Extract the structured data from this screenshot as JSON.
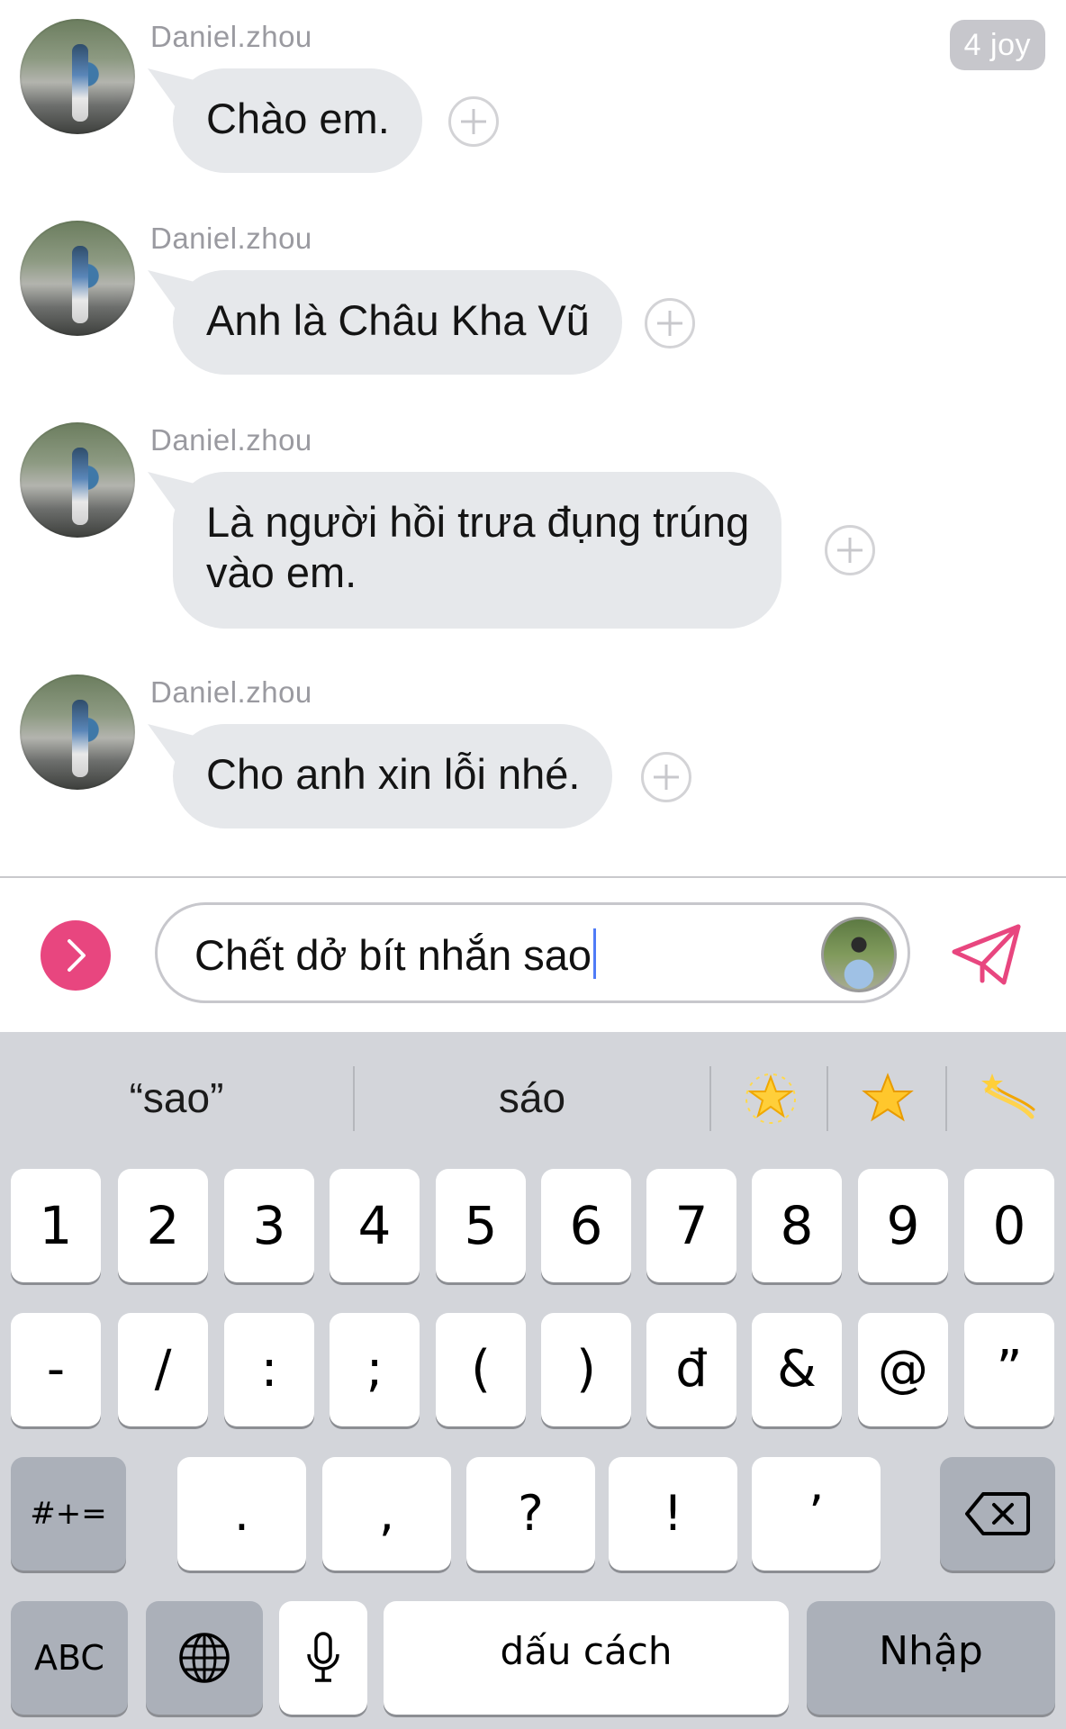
{
  "badge": "4 joy",
  "messages": [
    {
      "sender": "Daniel.zhou",
      "text": "Chào em."
    },
    {
      "sender": "Daniel.zhou",
      "text": "Anh là Châu Kha Vũ"
    },
    {
      "sender": "Daniel.zhou",
      "text": "Là người hồi trưa đụng trúng\nvào em."
    },
    {
      "sender": "Daniel.zhou",
      "text": "Cho anh xin lỗi nhé."
    }
  ],
  "composer": {
    "text": "Chết dở bít nhắn sao",
    "accent": "#e8467f"
  },
  "keyboard": {
    "suggestions": [
      "“sao”",
      "sáo"
    ],
    "emoji_icons": [
      "glowing-star-icon",
      "star-icon",
      "dizzy-icon"
    ],
    "row1": [
      "1",
      "2",
      "3",
      "4",
      "5",
      "6",
      "7",
      "8",
      "9",
      "0"
    ],
    "row2": [
      "-",
      "/",
      ":",
      ";",
      "(",
      ")",
      "đ",
      "&",
      "@",
      "”"
    ],
    "row3": [
      ".",
      ",",
      "?",
      "!",
      "’"
    ],
    "shift_label": "#+=",
    "abc_label": "ABC",
    "space_label": "dấu cách",
    "return_label": "Nhập"
  }
}
